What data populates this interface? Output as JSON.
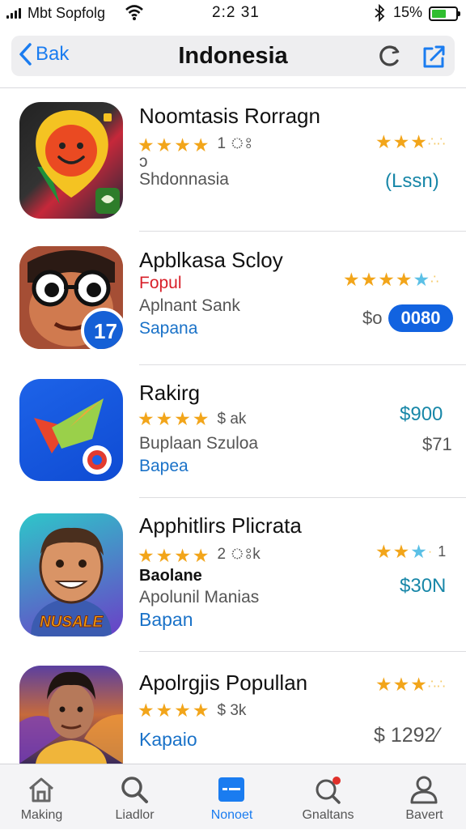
{
  "status_bar": {
    "carrier": "Mbt Sopfolg",
    "time": "2:2 31",
    "battery": "15%"
  },
  "nav": {
    "back_label": "Bak",
    "title": "Indonesia"
  },
  "apps": [
    {
      "name": "Noomtasis Rorragn",
      "rating_count": "1 ঃ",
      "line1": "ɔ",
      "line2": "Shdonnasia",
      "price": "(Lssn)",
      "icon": "smiley-pin-icon"
    },
    {
      "name": "Apblkasa Scloy",
      "line_red": "Fopul",
      "line1": "Aplnant Sank",
      "line2": "Sapana",
      "price_prefix": "$o",
      "price_button": "0080",
      "icon": "cartoon-face-icon"
    },
    {
      "name": "Rakirg",
      "rating_count": "$ ak",
      "line1": "Buplaan Szuloa",
      "line2": "Bapea",
      "price": "$900",
      "price2": "$71",
      "icon": "bird-logo-icon"
    },
    {
      "name": "Apphitlirs Plicrata",
      "rating_count": "2 ঃk",
      "line_dark": "Baolane",
      "line1": "Apolunil Manias",
      "line2": "Bapan",
      "price": "$30N",
      "right_count": "1",
      "icon": "man-portrait-icon",
      "icon_text": "NUSALE"
    },
    {
      "name": "Apolrgjis Popullan",
      "rating_count": "$ 3k",
      "line2": "Kapaio",
      "price": "$ 1292⁄",
      "icon": "man-photo-icon"
    }
  ],
  "tabs": [
    {
      "label": "Making",
      "icon": "home-icon"
    },
    {
      "label": "Liadlor",
      "icon": "search-icon"
    },
    {
      "label": "Nonoet",
      "icon": "card-icon"
    },
    {
      "label": "Gnaltans",
      "icon": "notification-search-icon"
    },
    {
      "label": "Bavert",
      "icon": "person-icon"
    }
  ],
  "colors": {
    "accent": "#1a7cf0",
    "star": "#f2a51a",
    "price": "#1887a8",
    "button": "#1263e0"
  }
}
